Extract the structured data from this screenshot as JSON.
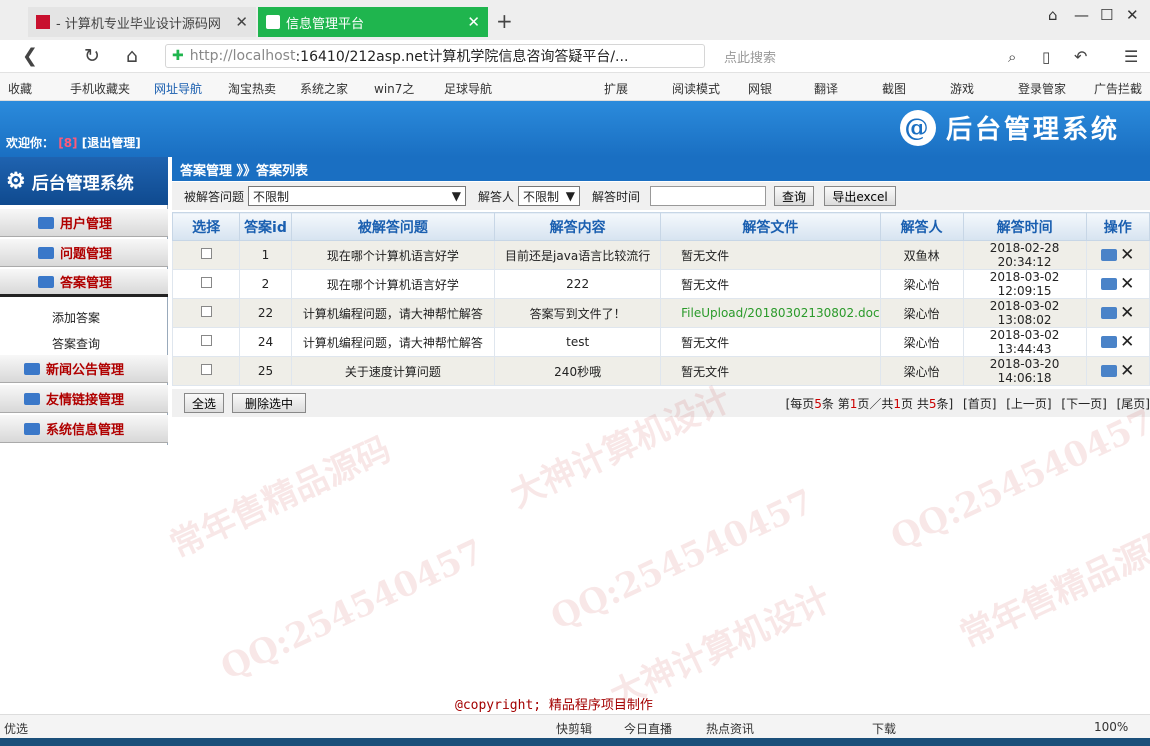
{
  "browser": {
    "tabs": [
      {
        "label": "- 计算机专业毕业设计源码网"
      },
      {
        "label": "信息管理平台"
      }
    ],
    "url_host": "http://localhost",
    "url_rest": ":16410/212asp.net计算机学院信息咨询答疑平台/...",
    "search_placeholder": "点此搜索",
    "bookmarks": [
      "收藏",
      "手机收藏夹",
      "网址导航",
      "淘宝热卖",
      "系统之家",
      "win7之",
      "足球导航",
      "扩展",
      "阅读模式",
      "网银",
      "翻译",
      "截图",
      "游戏",
      "登录管家",
      "广告拦截"
    ],
    "status_left": "优选",
    "status_items": [
      "快剪辑",
      "今日直播",
      "热点资讯",
      "下载",
      "100%"
    ]
  },
  "header": {
    "welcome": "欢迎你：",
    "user": "[8]",
    "logout": "[退出管理]",
    "brand": "后台管理系统"
  },
  "sidebar": {
    "title": "后台管理系统",
    "cats": [
      {
        "label": "用户管理"
      },
      {
        "label": "问题管理"
      },
      {
        "label": "答案管理"
      },
      {
        "label": "新闻公告管理"
      },
      {
        "label": "友情链接管理"
      },
      {
        "label": "系统信息管理"
      }
    ],
    "subs": [
      {
        "label": "添加答案"
      },
      {
        "label": "答案查询"
      }
    ]
  },
  "breadcrumb": "答案管理 》》答案列表",
  "filter": {
    "q_label": "被解答问题",
    "q_value": "不限制",
    "u_label": "解答人",
    "u_value": "不限制",
    "t_label": "解答时间",
    "t_value": "",
    "query_btn": "查询",
    "export_btn": "导出excel"
  },
  "table": {
    "headers": [
      "选择",
      "答案id",
      "被解答问题",
      "解答内容",
      "解答文件",
      "解答人",
      "解答时间",
      "操作"
    ],
    "rows": [
      {
        "id": "1",
        "question": "现在哪个计算机语言好学",
        "content": "目前还是java语言比较流行",
        "file": "暂无文件",
        "user": "双鱼林",
        "time": "2018-02-28 20:34:12"
      },
      {
        "id": "2",
        "question": "现在哪个计算机语言好学",
        "content": "222",
        "file": "暂无文件",
        "user": "梁心怡",
        "time": "2018-03-02 12:09:15"
      },
      {
        "id": "22",
        "question": "计算机编程问题，请大神帮忙解答",
        "content": "答案写到文件了！",
        "file": "FileUpload/20180302130802.doc",
        "user": "梁心怡",
        "time": "2018-03-02 13:08:02"
      },
      {
        "id": "24",
        "question": "计算机编程问题，请大神帮忙解答",
        "content": "test",
        "file": "暂无文件",
        "user": "梁心怡",
        "time": "2018-03-02 13:44:43"
      },
      {
        "id": "25",
        "question": "关于速度计算问题",
        "content": "240秒哦",
        "file": "暂无文件",
        "user": "梁心怡",
        "time": "2018-03-20 14:06:18"
      }
    ]
  },
  "pager": {
    "select_all": "全选",
    "delete_selected": "删除选中",
    "info_pre": "[每页",
    "per_page": "5",
    "info_mid1": "条 第",
    "page": "1",
    "info_mid2": "页／共",
    "pages": "1",
    "info_mid3": "页 共",
    "total": "5",
    "info_end": "条]",
    "first": "[首页]",
    "prev": "[上一页]",
    "next": "[下一页]",
    "last": "[尾页]"
  },
  "copyright": "@copyright; 精品程序项目制作",
  "watermarks": [
    "QQ:254540457",
    "常年售精品源码",
    "大神计算机设计"
  ]
}
